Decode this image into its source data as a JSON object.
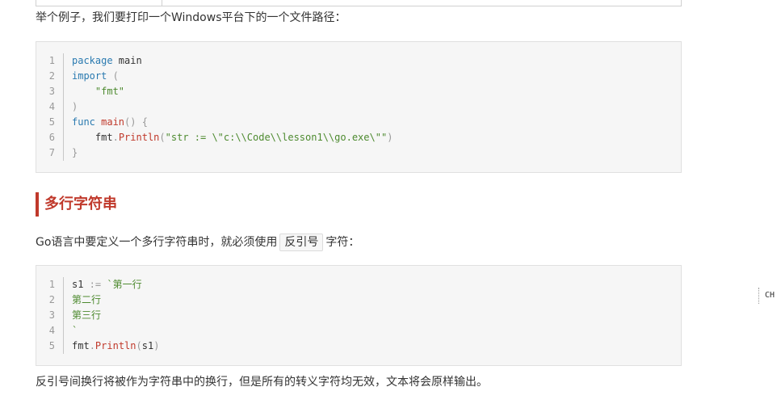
{
  "intro_text": "举个例子，我们要打印一个Windows平台下的一个文件路径：",
  "code_block_1": {
    "line_numbers": [
      "1",
      "2",
      "3",
      "4",
      "5",
      "6",
      "7"
    ],
    "tokens": {
      "package_kw": "package",
      "package_name": " main",
      "import_kw": "import",
      "import_open": " (",
      "import_path": "    \"fmt\"",
      "import_close": ")",
      "func_kw": "func",
      "main_fn": " main",
      "main_parens": "() {",
      "indent": "    ",
      "fmt_pkg": "fmt",
      "dot": ".",
      "println_fn": "Println",
      "paren_open": "(",
      "println_arg": "\"str := \\\"c:\\\\Code\\\\lesson1\\\\go.exe\\\"\"",
      "paren_close": ")",
      "brace_close": "}"
    }
  },
  "section_heading": "多行字符串",
  "multiline_text": {
    "before": "Go语言中要定义一个多行字符串时，就必须使用",
    "inline_code": "反引号",
    "after": "字符："
  },
  "code_block_2": {
    "line_numbers": [
      "1",
      "2",
      "3",
      "4",
      "5"
    ],
    "tokens": {
      "var": "s1",
      "assign": " :=",
      "line1": " `第一行",
      "line2": "第二行",
      "line3": "第三行",
      "backtick_close": "`",
      "fmt_pkg": "fmt",
      "dot": ".",
      "println_fn": "Println",
      "call_open": "(",
      "arg": "s1",
      "call_close": ")"
    }
  },
  "closing_text": "反引号间换行将被作为字符串中的换行，但是所有的转义字符均无效，文本将会原样输出。",
  "side_badge": "CH"
}
